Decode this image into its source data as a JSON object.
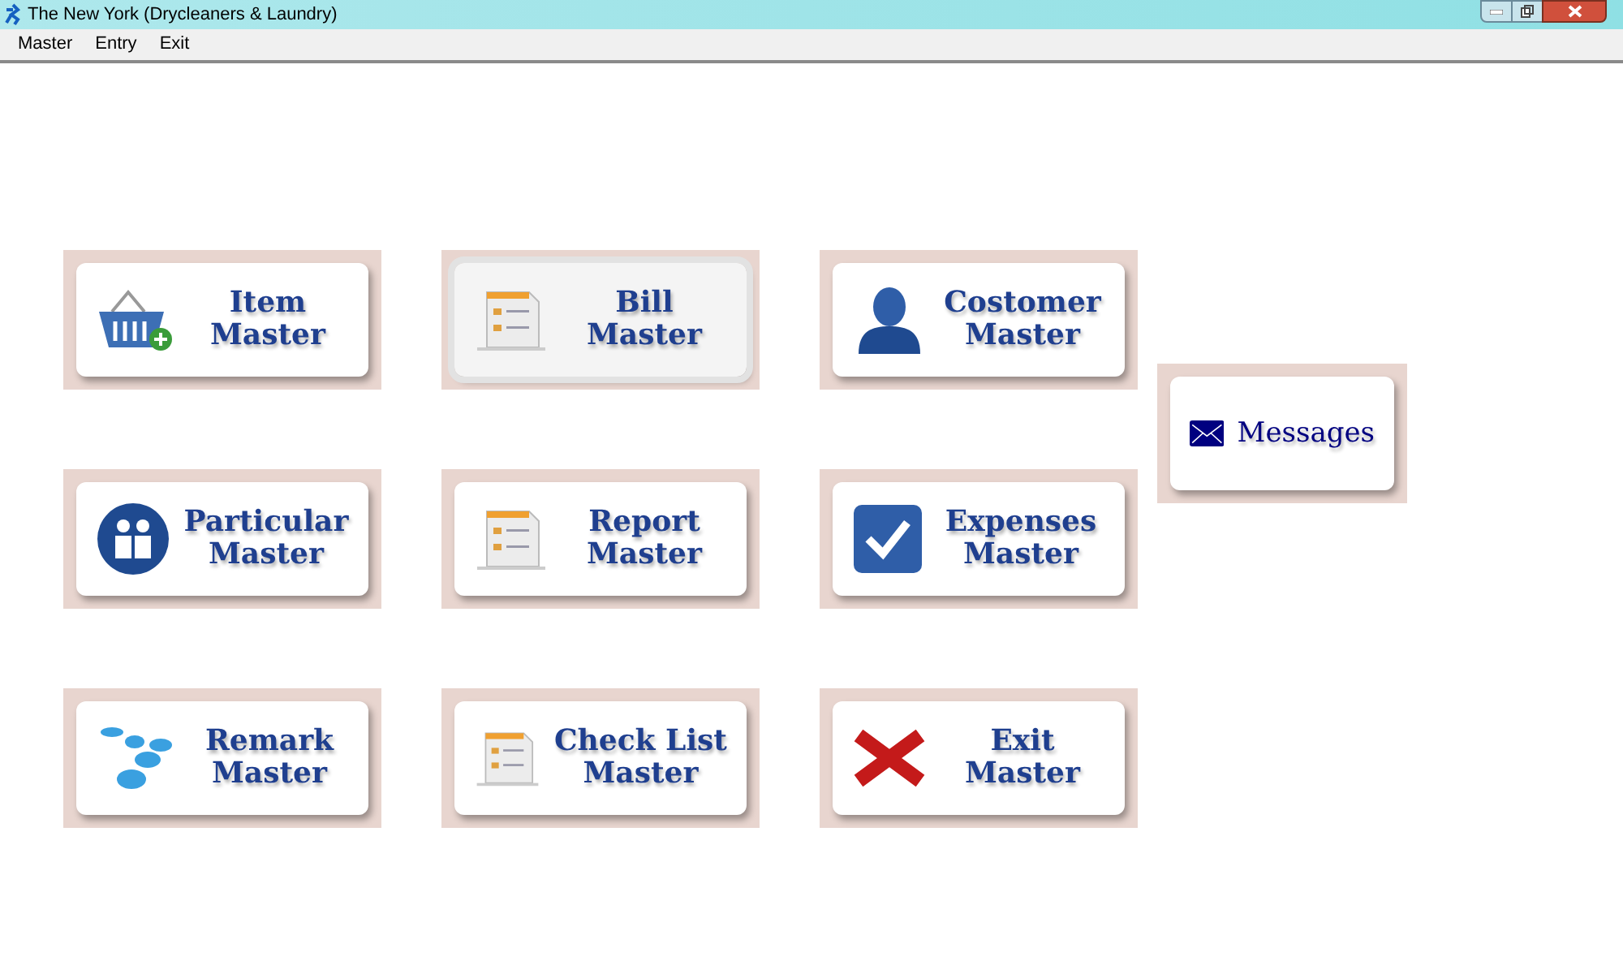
{
  "window": {
    "title": "The New York (Drycleaners & Laundry)"
  },
  "menu": [
    "Master",
    "Entry",
    "Exit"
  ],
  "tiles": [
    {
      "kind": "basket",
      "lines": [
        "Item",
        "Master"
      ],
      "selected": false
    },
    {
      "kind": "document",
      "lines": [
        "Bill",
        "Master"
      ],
      "selected": true
    },
    {
      "kind": "person",
      "lines": [
        "Costomer",
        "Master"
      ],
      "selected": false
    },
    {
      "kind": "people",
      "lines": [
        "Particular",
        "Master"
      ],
      "selected": false
    },
    {
      "kind": "document",
      "lines": [
        "Report",
        "Master"
      ],
      "selected": false
    },
    {
      "kind": "check",
      "lines": [
        "Expenses",
        "Master"
      ],
      "selected": false
    },
    {
      "kind": "bubbles",
      "lines": [
        "Remark",
        "Master"
      ],
      "selected": false
    },
    {
      "kind": "document",
      "lines": [
        "Check List",
        "Master"
      ],
      "selected": false
    },
    {
      "kind": "cross",
      "lines": [
        "Exit",
        "Master"
      ],
      "selected": false
    }
  ],
  "side_tile": {
    "kind": "envelope",
    "lines": [
      "Messages"
    ],
    "selected": false
  }
}
